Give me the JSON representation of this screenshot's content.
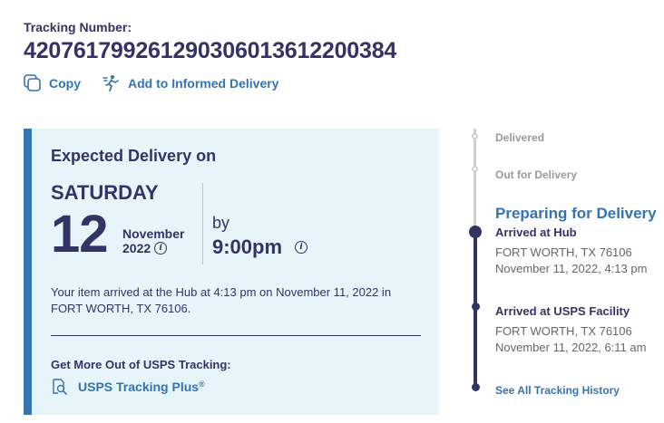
{
  "tracking": {
    "label": "Tracking Number:",
    "number": "420761799261290306013612200384"
  },
  "actions": {
    "copy_label": "Copy",
    "informed_label": "Add to Informed Delivery"
  },
  "expected": {
    "label": "Expected Delivery on",
    "day_of_week": "SATURDAY",
    "day": "12",
    "month": "November",
    "year": "2022",
    "by_label": "by",
    "time": "9:00pm",
    "message": "Your item arrived at the Hub at 4:13 pm on November 11, 2022 in FORT WORTH, TX 76106.",
    "more_label": "Get More Out of USPS Tracking:",
    "plus_label": "USPS Tracking Plus",
    "plus_mark": "®"
  },
  "timeline": {
    "steps": [
      "Delivered",
      "Out for Delivery"
    ],
    "current_status": "Preparing for Delivery",
    "events": [
      {
        "title": "Arrived at Hub",
        "location": "FORT WORTH, TX 76106",
        "datetime": "November 11, 2022, 4:13 pm"
      },
      {
        "title": "Arrived at USPS Facility",
        "location": "FORT WORTH, TX 76106",
        "datetime": "November 11, 2022, 6:11 am"
      }
    ],
    "history_link": "See All Tracking History"
  },
  "colors": {
    "navy": "#333366",
    "link_blue": "#3573b1",
    "panel_bg": "#e6f5fa",
    "grey": "#999999"
  }
}
